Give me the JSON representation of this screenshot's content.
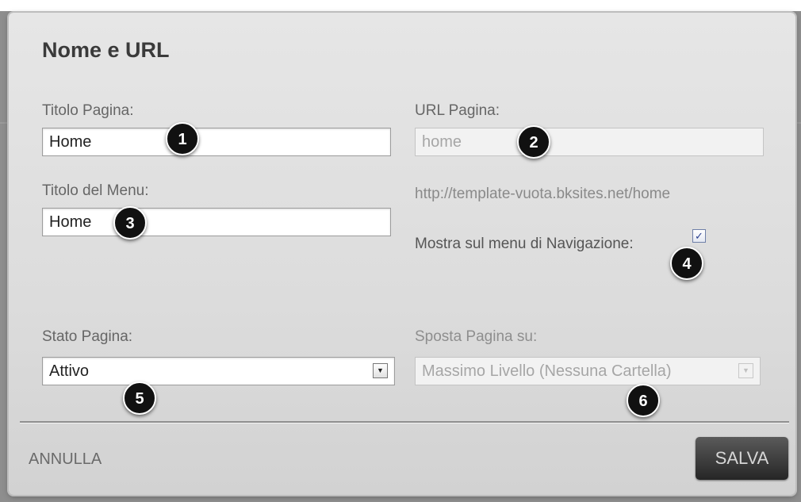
{
  "dialog": {
    "title": "Nome e URL",
    "page_title": {
      "label": "Titolo Pagina:",
      "value": "Home"
    },
    "page_url": {
      "label": "URL Pagina:",
      "value": "home",
      "full_url": "http://template-vuota.bksites.net/home"
    },
    "menu_title": {
      "label": "Titolo del Menu:",
      "value": "Home"
    },
    "show_in_nav": {
      "label": "Mostra sul menu di Navigazione:",
      "checked": true,
      "glyph": "✓"
    },
    "page_status": {
      "label": "Stato Pagina:",
      "value": "Attivo"
    },
    "move_page": {
      "label": "Sposta Pagina su:",
      "value": "Massimo Livello (Nessuna Cartella)"
    },
    "cancel_label": "ANNULLA",
    "save_label": "SALVA"
  },
  "markers": [
    "1",
    "2",
    "3",
    "4",
    "5",
    "6"
  ],
  "icons": {
    "dropdown_arrow": "▼"
  }
}
